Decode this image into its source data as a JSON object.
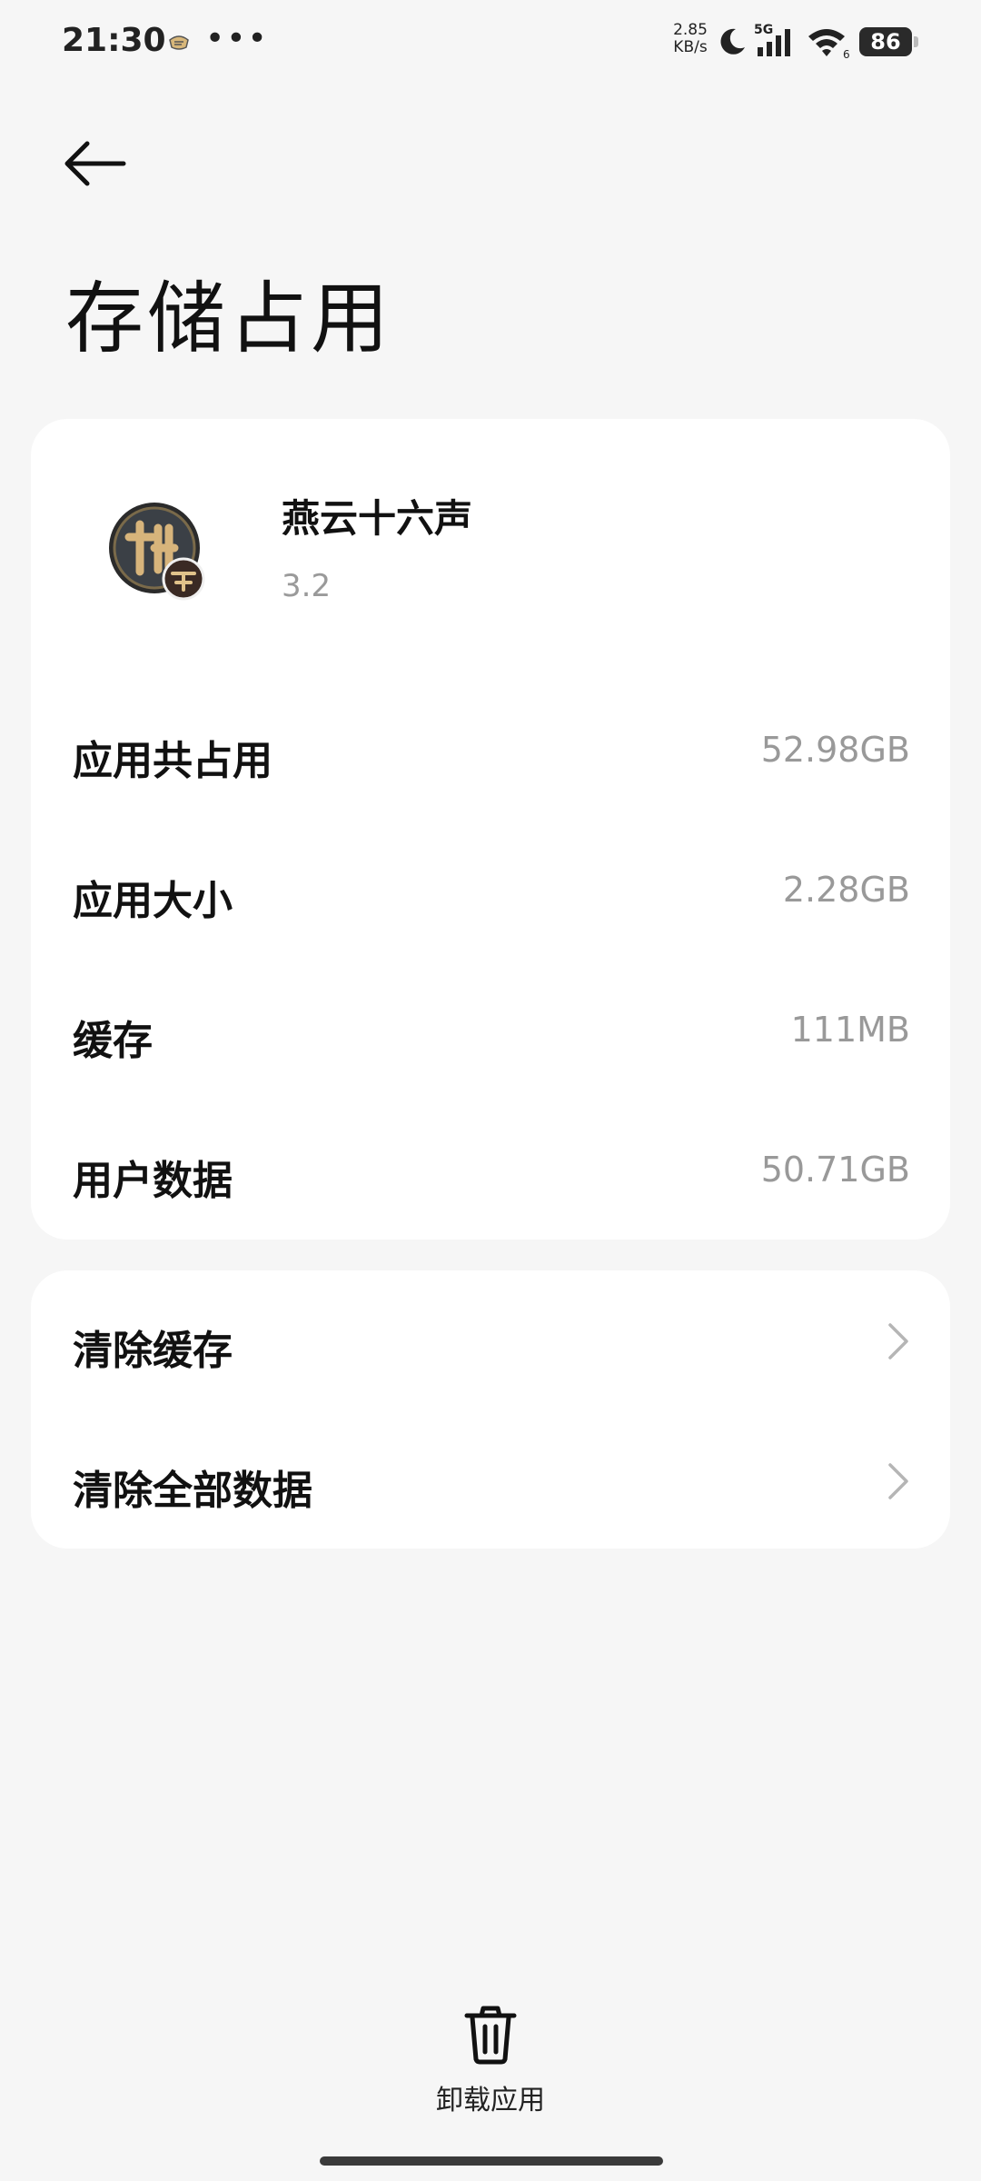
{
  "status_bar": {
    "time": "21:30",
    "more": "•••",
    "net_speed_value": "2.85",
    "net_speed_unit": "KB/s",
    "network_type": "5G",
    "wifi_badge": "6",
    "battery": "86",
    "icons": [
      "notification-icon",
      "moon-icon",
      "signal-icon",
      "wifi-icon",
      "battery-icon"
    ]
  },
  "header": {
    "title": "存储占用",
    "back_icon": "arrow-left-icon"
  },
  "app": {
    "name": "燕云十六声",
    "version": "3.2"
  },
  "storage": {
    "rows": [
      {
        "label": "应用共占用",
        "value": "52.98GB"
      },
      {
        "label": "应用大小",
        "value": "2.28GB"
      },
      {
        "label": "缓存",
        "value": "111MB"
      },
      {
        "label": "用户数据",
        "value": "50.71GB"
      }
    ]
  },
  "actions": {
    "rows": [
      {
        "label": "清除缓存"
      },
      {
        "label": "清除全部数据"
      }
    ]
  },
  "footer": {
    "uninstall_label": "卸载应用",
    "uninstall_icon": "trash-icon"
  },
  "colors": {
    "background": "#f6f6f6",
    "card": "#ffffff",
    "secondary_text": "#999999"
  }
}
